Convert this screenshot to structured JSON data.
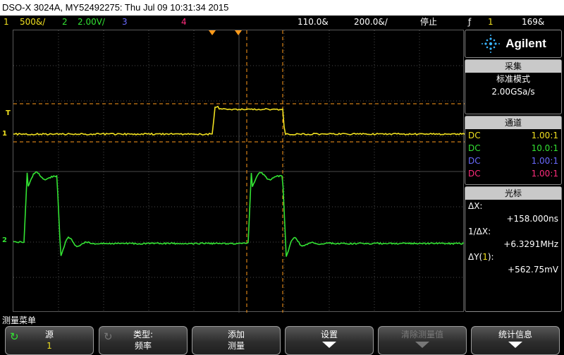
{
  "title_bar": "DSO-X 3024A, MY52492275: Thu Jul 09 10:31:34 2015",
  "status": {
    "ch1_num": "1",
    "ch1_scale": "500&/",
    "ch2_num": "2",
    "ch2_scale": "2.00V/",
    "ch3_num": "3",
    "ch4_num": "4",
    "delay": "110.0&",
    "timebase": "200.0&/",
    "run_state": "停止",
    "trigger_icon": "ƒ",
    "trigger_source": "1",
    "trigger_level": "169&"
  },
  "colors": {
    "ch1": "#f0e020",
    "ch2": "#33e233",
    "ch3": "#6a6aff",
    "ch4": "#ff2c7c",
    "cursor": "#ff9a1a"
  },
  "markers": {
    "ch1_ground": "1",
    "trig_level": "T",
    "ch2_ground": "2"
  },
  "side_panel": {
    "brand": "Agilent",
    "acq_head": "采集",
    "acq_mode": "标准模式",
    "acq_rate": "2.00GSa/s",
    "chan_head": "通道",
    "channels": [
      {
        "coupling": "DC",
        "probe": "1.00:1"
      },
      {
        "coupling": "DC",
        "probe": "10.0:1"
      },
      {
        "coupling": "DC",
        "probe": "1.00:1"
      },
      {
        "coupling": "DC",
        "probe": "1.00:1"
      }
    ],
    "cursor_head": "光标",
    "dx_label": "ΔX:",
    "dx_value": "+158.000ns",
    "inv_dx_label": "1/ΔX:",
    "inv_dx_value": "+6.3291MHz",
    "dy_label": "ΔY(",
    "dy_chan": "1",
    "dy_label_end": "):",
    "dy_value": "+562.75mV"
  },
  "menu_title": "测量菜单",
  "softkeys": [
    {
      "line1": "源",
      "line2": "1"
    },
    {
      "line1": "类型:",
      "line2": "频率"
    },
    {
      "line1": "添加",
      "line2": "测量"
    },
    {
      "line1": "设置",
      "line2": ""
    },
    {
      "line1": "清除测量值",
      "line2": ""
    },
    {
      "line1": "统计信息",
      "line2": ""
    }
  ]
}
